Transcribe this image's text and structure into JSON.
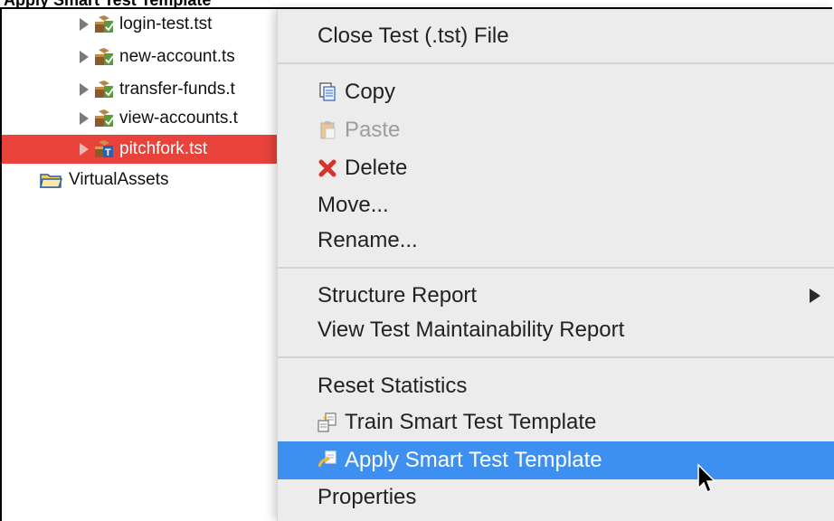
{
  "header_fragment": "Apply Smart Test Template",
  "tree": {
    "items": [
      {
        "label": "login-test.tst",
        "icon": "test-file-icon"
      },
      {
        "label": "new-account.ts",
        "icon": "test-file-icon"
      },
      {
        "label": "transfer-funds.t",
        "icon": "test-file-icon"
      },
      {
        "label": "view-accounts.t",
        "icon": "test-file-icon"
      },
      {
        "label": "pitchfork.tst",
        "icon": "template-file-icon"
      },
      {
        "label": "VirtualAssets",
        "icon": "folder-icon"
      }
    ]
  },
  "menu": {
    "close_test": "Close Test (.tst) File",
    "copy": "Copy",
    "paste": "Paste",
    "delete": "Delete",
    "move": "Move...",
    "rename": "Rename...",
    "structure_report": "Structure Report",
    "view_maintainability": "View Test Maintainability Report",
    "reset_statistics": "Reset Statistics",
    "train_template": "Train Smart Test Template",
    "apply_template": "Apply Smart Test Template",
    "properties": "Properties"
  },
  "colors": {
    "selection_red": "#e9423b",
    "menu_highlight": "#3d8ff0",
    "menu_background": "#ececec"
  }
}
